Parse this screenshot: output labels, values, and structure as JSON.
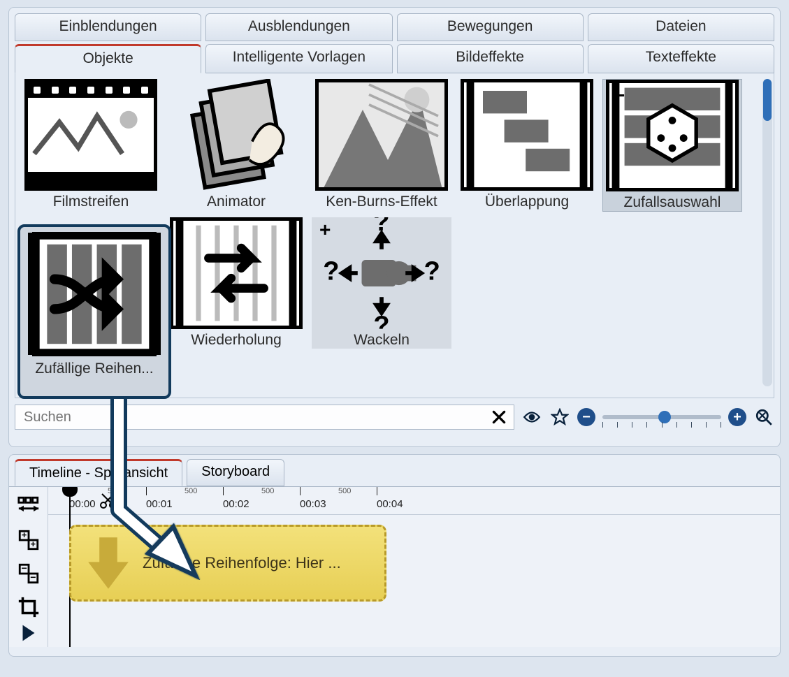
{
  "tabs_row1": [
    "Einblendungen",
    "Ausblendungen",
    "Bewegungen",
    "Dateien"
  ],
  "tabs_row2": [
    "Objekte",
    "Intelligente Vorlagen",
    "Bildeffekte",
    "Texteffekte"
  ],
  "active_tab_row2_index": 0,
  "items": [
    {
      "label": "Filmstreifen"
    },
    {
      "label": "Animator"
    },
    {
      "label": "Ken-Burns-Effekt"
    },
    {
      "label": "Überlappung"
    },
    {
      "label": "Zufallsauswahl",
      "badge": "−",
      "selected": true
    },
    {
      "label": "Zufällige Reihen..."
    },
    {
      "label": "Wiederholung"
    },
    {
      "label": "Wackeln",
      "badge": "+"
    }
  ],
  "drag_card_label": "Zufällige Reihen...",
  "search": {
    "placeholder": "Suchen"
  },
  "timeline": {
    "tabs": [
      "Timeline - Spuransicht",
      "Storyboard"
    ],
    "active_index": 0,
    "ticks": [
      "00:00",
      "00:01",
      "00:02",
      "00:03",
      "00:04"
    ],
    "subtick": "500",
    "clip_label": "Zufällige Reihenfolge: Hier ..."
  }
}
